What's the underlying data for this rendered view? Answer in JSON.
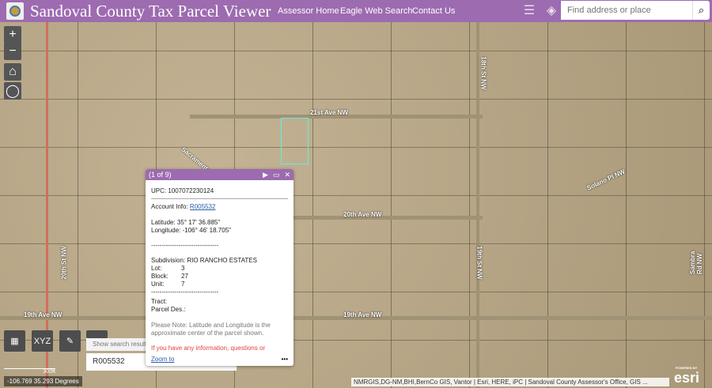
{
  "header": {
    "title": "Sandoval County Tax Parcel Viewer",
    "links": [
      "Assessor Home",
      "Eagle Web Search",
      "Contact Us"
    ],
    "search_placeholder": "Find address or place"
  },
  "icons": [
    "legend-icon",
    "layers-icon",
    "search-icon",
    "zoom-in-icon",
    "zoom-out-icon",
    "home-icon",
    "locate-icon",
    "basemap-gallery-icon",
    "xyz-coordinate-icon",
    "measure-icon"
  ],
  "map": {
    "streets": [
      "21st Ave NW",
      "20th Ave NW",
      "19th Ave NW",
      "20th St NW",
      "19th St NW",
      "18th St NW",
      "Solano Pl NW",
      "Sambra Rd NW",
      "Sacramento"
    ],
    "xyz_label": "XYZ",
    "scale": "300ft",
    "coords": "-106.769 35.293 Degrees",
    "attribution": "NMRGIS,DG-NM,BHI,BernCo GIS, Vantor | Esri, HERE, iPC | Sandoval County Assessor's Office, GIS ...",
    "esri_powered": "POWERED BY",
    "esri": "esri"
  },
  "popup": {
    "counter": "(1 of 9)",
    "upc": "UPC: 1007072230124",
    "account_label": "Account Info: ",
    "account": "R005532",
    "latitude": "Latitude: 35° 17' 36.885\"",
    "longitude": "Longitude: -106° 46' 18.705\"",
    "dashes": "--------------------------------",
    "subdivision": "Subdivision: RIO RANCHO ESTATES",
    "lot_label": "Lot:",
    "lot": "3",
    "block_label": "Block:",
    "block": "27",
    "unit_label": "Unit:",
    "unit": "7",
    "tract": "Tract:",
    "parcel_des": "Parcel Des.:",
    "note": "Please Note: Latitude and Longitude is the approximate center of the parcel shown.",
    "info": "If you have any information, questions or",
    "zoom_to": "Zoom to",
    "more": "•••"
  },
  "search_results": {
    "hint": "Show search results",
    "value": "R005532"
  },
  "colors": {
    "header": "#9d6bb0",
    "popup_link": "#2a5ca8",
    "warning": "#e0443c",
    "parcel_highlight": "#5ef0e0"
  }
}
